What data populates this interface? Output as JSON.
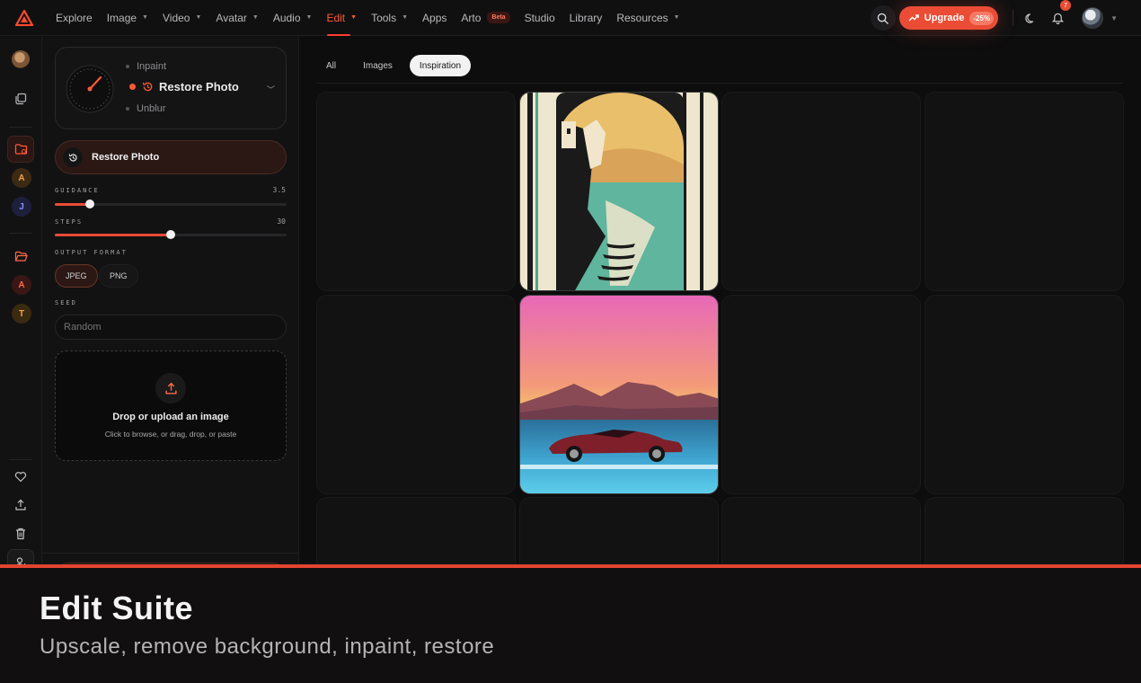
{
  "nav": {
    "items": [
      {
        "label": "Explore",
        "caret": false
      },
      {
        "label": "Image",
        "caret": true
      },
      {
        "label": "Video",
        "caret": true
      },
      {
        "label": "Avatar",
        "caret": true
      },
      {
        "label": "Audio",
        "caret": true
      },
      {
        "label": "Edit",
        "caret": true,
        "active": true
      },
      {
        "label": "Tools",
        "caret": true
      },
      {
        "label": "Apps",
        "caret": false
      },
      {
        "label": "Arto",
        "caret": false
      },
      {
        "label": "Studio",
        "caret": false
      },
      {
        "label": "Library",
        "caret": false
      },
      {
        "label": "Resources",
        "caret": true
      }
    ],
    "arto_badge": "Beta",
    "upgrade_label": "Upgrade",
    "upgrade_discount": "-25%",
    "notification_count": "7",
    "accent_color": "#ea4c36"
  },
  "rail": {
    "letters": [
      "A",
      "J",
      "A",
      "T"
    ]
  },
  "panel": {
    "model_options": {
      "above": "Inpaint",
      "selected": "Restore Photo",
      "below": "Unblur"
    },
    "action_button": "Restore Photo",
    "guidance": {
      "label": "GUIDANCE",
      "value": "3.5",
      "fraction": 0.15
    },
    "steps": {
      "label": "STEPS",
      "value": "30",
      "fraction": 0.5
    },
    "output_format": {
      "label": "OUTPUT FORMAT",
      "options": [
        "JPEG",
        "PNG"
      ],
      "selected": "JPEG"
    },
    "seed": {
      "label": "SEED",
      "placeholder": "Random"
    },
    "upload": {
      "title": "Drop or upload an image",
      "subtitle": "Click to browse, or drag, drop, or paste"
    }
  },
  "main": {
    "tabs": [
      {
        "label": "All",
        "active": false
      },
      {
        "label": "Images",
        "active": false
      },
      {
        "label": "Inspiration",
        "active": true
      }
    ]
  },
  "banner": {
    "title": "Edit Suite",
    "subtitle": "Upscale, remove background, inpaint, restore"
  }
}
